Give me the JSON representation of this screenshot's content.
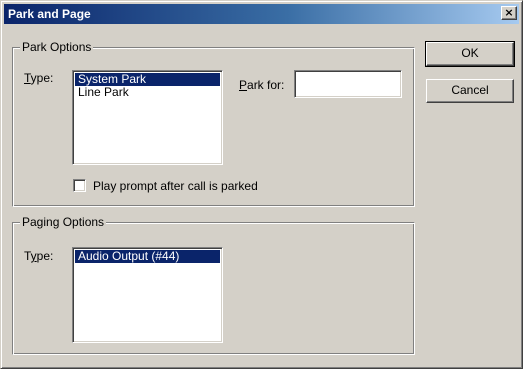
{
  "window": {
    "title": "Park and Page",
    "close_label": "×"
  },
  "park_options": {
    "legend": "Park Options",
    "type_label_accel": "T",
    "type_label_rest": "ype:",
    "type_items": [
      {
        "label": "System Park",
        "selected": true
      },
      {
        "label": "Line Park",
        "selected": false
      }
    ],
    "park_for_label_accel": "P",
    "park_for_label_rest": "ark for:",
    "park_for_value": "",
    "play_prompt_label": "Play prompt after call is parked",
    "play_prompt_checked": false
  },
  "paging_options": {
    "legend": "Paging Options",
    "type_label_prefix": "T",
    "type_label_accel": "y",
    "type_label_rest": "pe:",
    "type_items": [
      {
        "label": "Audio Output (#44)",
        "selected": true
      }
    ]
  },
  "buttons": {
    "ok_label": "OK",
    "cancel_label": "Cancel"
  }
}
